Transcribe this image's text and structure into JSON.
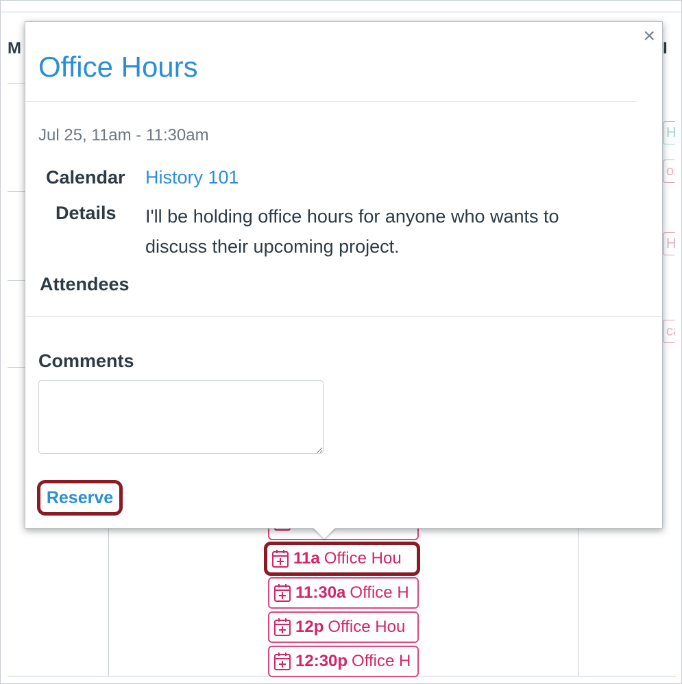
{
  "calendar_background": {
    "day_headers": [
      "M",
      "I"
    ],
    "fragments": [
      "H",
      "on",
      "Hi",
      "ca"
    ]
  },
  "slots": [
    {
      "time": "11a",
      "title": "Office Hou",
      "highlighted": true
    },
    {
      "time": "11:30a",
      "title": "Office H",
      "highlighted": false
    },
    {
      "time": "12p",
      "title": "Office Hou",
      "highlighted": false
    },
    {
      "time": "12:30p",
      "title": "Office H",
      "highlighted": false
    }
  ],
  "popover": {
    "title": "Office Hours",
    "close_symbol": "×",
    "date_range": "Jul 25, 11am - 11:30am",
    "calendar_label": "Calendar",
    "calendar_value": "History 101",
    "details_label": "Details",
    "details_text": "I'll be holding office hours for anyone who wants to discuss their upcoming project.",
    "attendees_label": "Attendees",
    "comments_label": "Comments",
    "comments_value": "",
    "reserve_label": "Reserve"
  },
  "colors": {
    "link_blue": "#2b8ed8",
    "event_pink": "#d4246a",
    "highlight_maroon": "#8b1a24"
  },
  "icons": {
    "slot_icon": "calendar-plus-icon",
    "close_icon": "close-icon"
  }
}
